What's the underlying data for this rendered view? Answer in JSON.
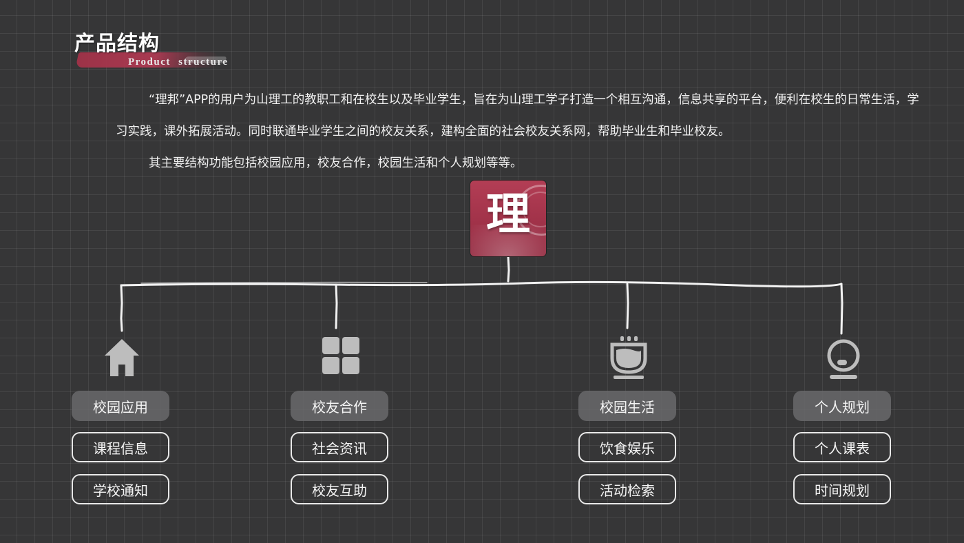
{
  "header": {
    "title_cn": "产品结构",
    "title_en": "Product  structure"
  },
  "intro": {
    "paragraph1": "“理邦”APP的用户为山理工的教职工和在校生以及毕业学生，旨在为山理工学子打造一个相互沟通，信息共享的平台，便利在校生的日常生活，学习实践，课外拓展活动。同时联通毕业学生之间的校友关系，建构全面的社会校友关系网，帮助毕业生和毕业校友。",
    "paragraph2": "其主要结构功能包括校园应用，校友合作，校园生活和个人规划等等。"
  },
  "root": {
    "label": "理",
    "color": "#a8374f"
  },
  "branches": [
    {
      "icon": "house-icon",
      "title": "校园应用",
      "items": [
        "课程信息",
        "学校通知"
      ]
    },
    {
      "icon": "grid-icon",
      "title": "校友合作",
      "items": [
        "社会资讯",
        "校友互助"
      ]
    },
    {
      "icon": "coffee-cup-icon",
      "title": "校园生活",
      "items": [
        "饮食娱乐",
        "活动检索"
      ]
    },
    {
      "icon": "webcam-icon",
      "title": "个人规划",
      "items": [
        "个人课表",
        "时间规划"
      ]
    }
  ],
  "colors": {
    "background": "#363637",
    "accent": "#a8374f",
    "line": "#f2f2f2",
    "icon": "#bdbdbd"
  }
}
